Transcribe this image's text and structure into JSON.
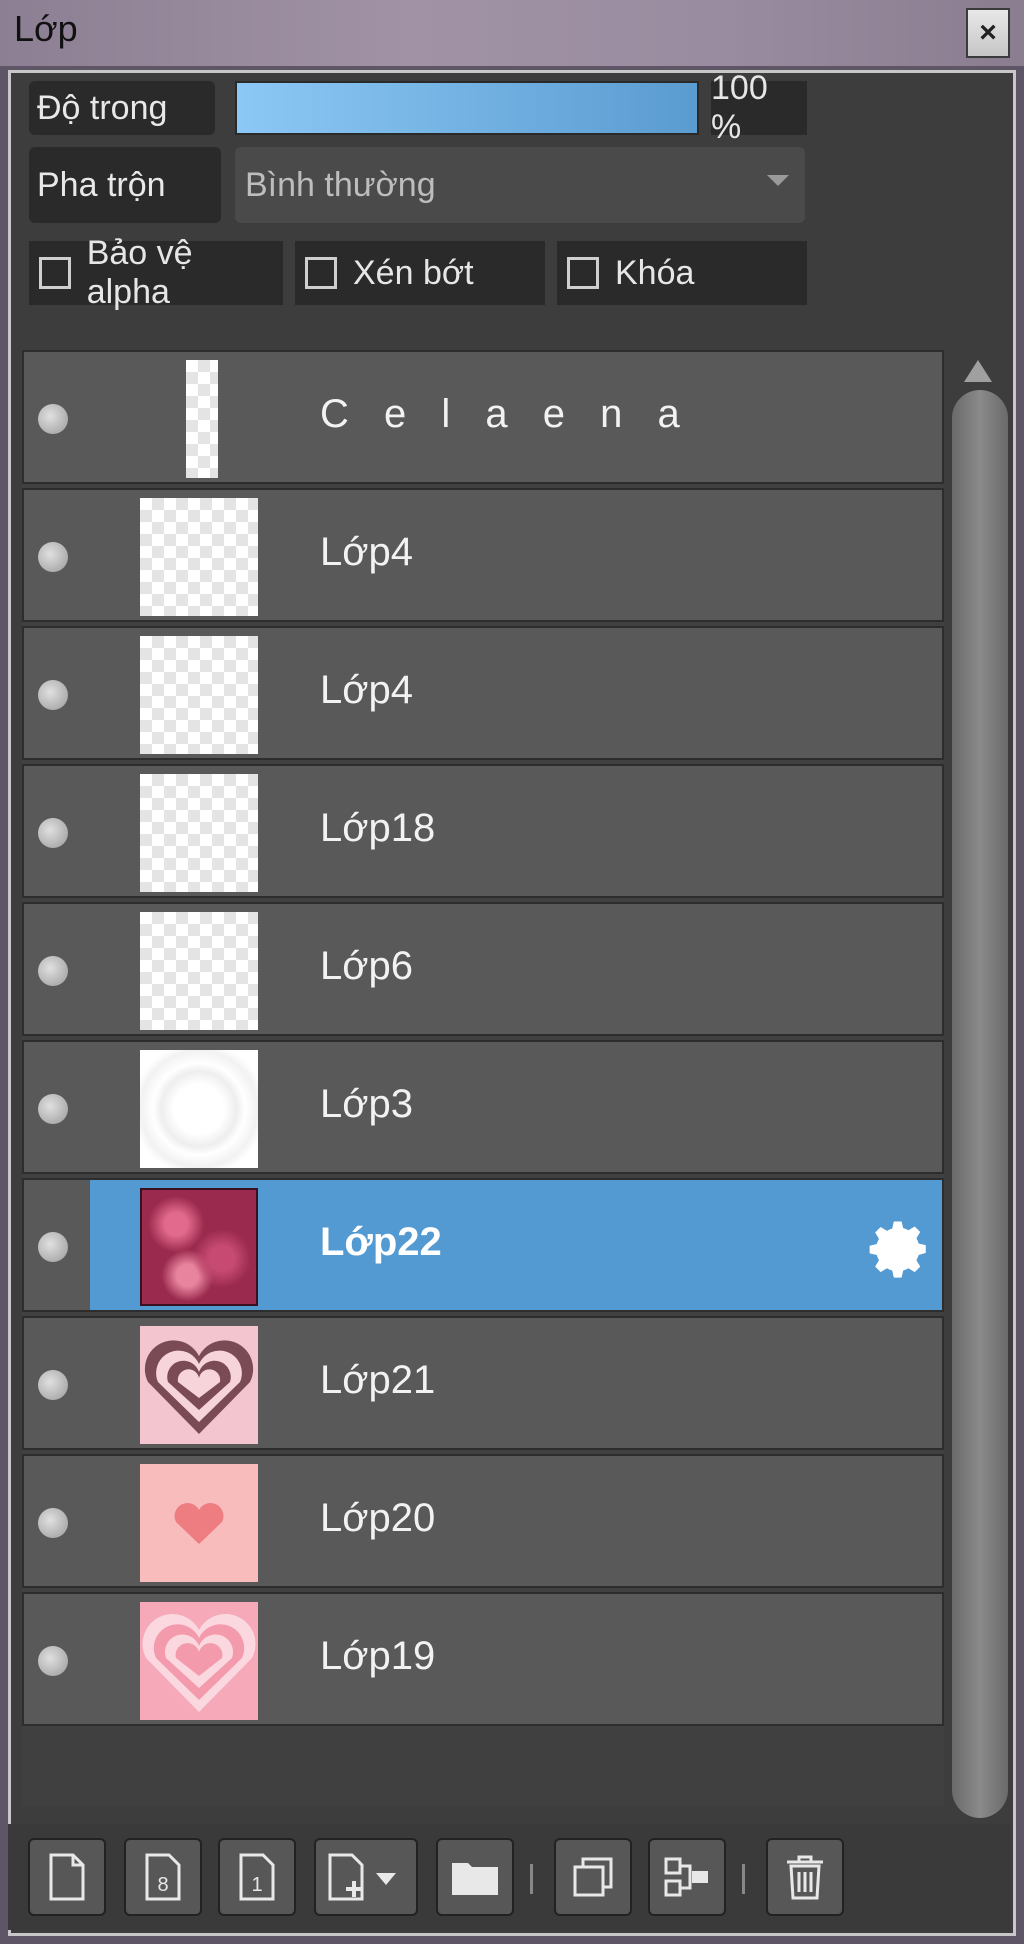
{
  "window": {
    "title": "Lớp",
    "close_glyph": "×"
  },
  "opacity": {
    "label": "Độ trong",
    "value_text": "100 %",
    "fraction": 1.0
  },
  "blend": {
    "label": "Pha trộn",
    "selected": "Bình thường"
  },
  "checks": [
    {
      "label": "Bảo vệ alpha",
      "checked": false
    },
    {
      "label": "Xén bớt",
      "checked": false
    },
    {
      "label": "Khóa",
      "checked": false
    }
  ],
  "layers": [
    {
      "name": "C e l a e n a",
      "selected": false
    },
    {
      "name": "Lớp4",
      "selected": false
    },
    {
      "name": "Lớp4",
      "selected": false
    },
    {
      "name": "Lớp18",
      "selected": false
    },
    {
      "name": "Lớp6",
      "selected": false
    },
    {
      "name": "Lớp3",
      "selected": false
    },
    {
      "name": "Lớp22",
      "selected": true
    },
    {
      "name": "Lớp21",
      "selected": false
    },
    {
      "name": "Lớp20",
      "selected": false
    },
    {
      "name": "Lớp19",
      "selected": false
    }
  ],
  "toolbar": {
    "icons": [
      "new-layer-icon",
      "new-layer-8bit-icon",
      "new-layer-1bit-icon",
      "add-layer-menu-icon",
      "new-folder-icon",
      "duplicate-layer-icon",
      "merge-down-icon",
      "delete-layer-icon"
    ]
  },
  "colors": {
    "accent": "#539ad2",
    "row": "#595959",
    "panel": "#3d3d3d"
  }
}
